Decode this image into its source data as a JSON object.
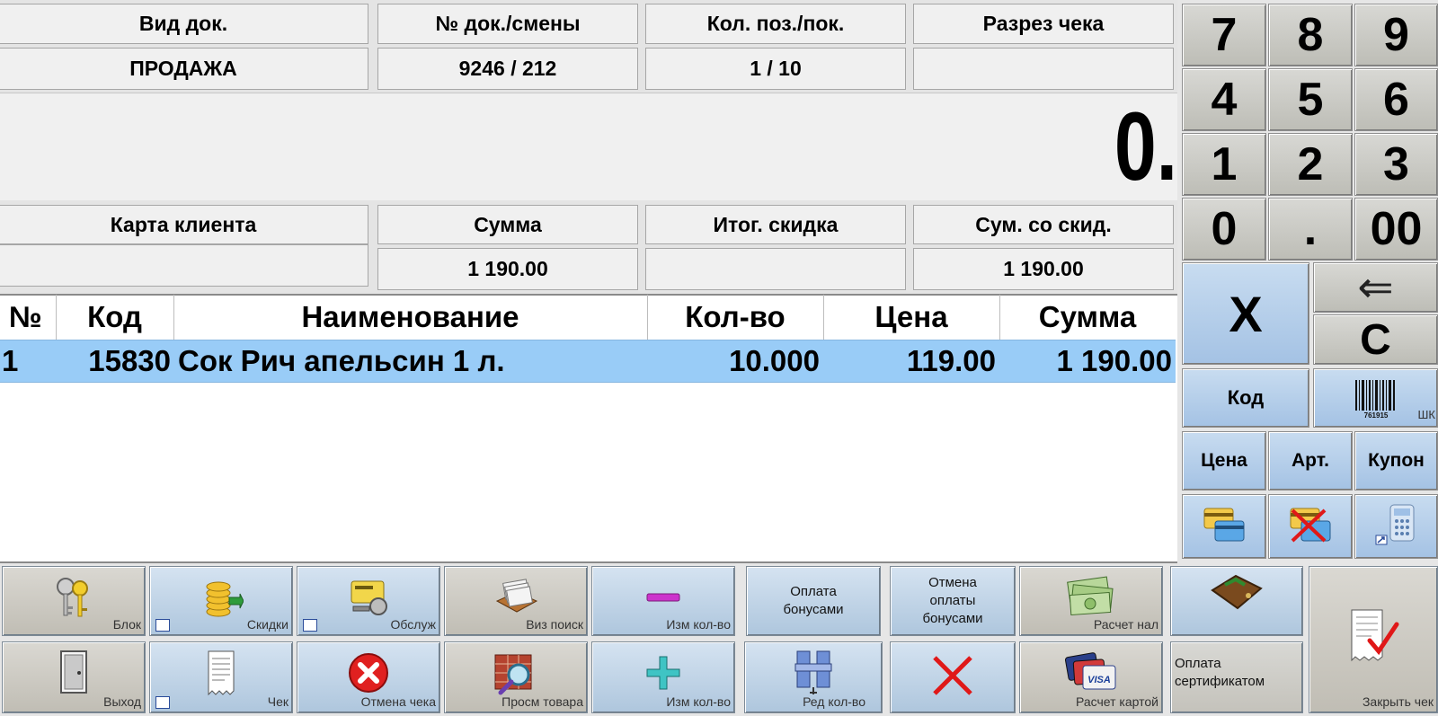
{
  "info_headers": [
    "Вид док.",
    "№ док./смены",
    "Кол. поз./пок.",
    "Разрез чека"
  ],
  "info_values": [
    "ПРОДАЖА",
    "9246 / 212",
    "1 / 10",
    ""
  ],
  "display_value": "0.",
  "summary_headers": [
    "Карта клиента",
    "Сумма",
    "Итог. скидка",
    "Сум. со скид."
  ],
  "summary_values": [
    "",
    "1 190.00",
    "",
    "1 190.00"
  ],
  "table": {
    "columns": [
      "№",
      "Код",
      "Наименование",
      "Кол-во",
      "Цена",
      "Сумма"
    ],
    "rows": [
      {
        "num": "1",
        "code": "15830",
        "name": "Сок Рич апельсин 1 л.",
        "qty": "10.000",
        "price": "119.00",
        "sum": "1 190.00"
      }
    ]
  },
  "keypad": {
    "digits": [
      "7",
      "8",
      "9",
      "4",
      "5",
      "6",
      "1",
      "2",
      "3",
      "0",
      ".",
      "00"
    ],
    "multiply": "X",
    "backspace": "⇐",
    "clear": "C",
    "code": "Код",
    "barcode": "ШК",
    "price": "Цена",
    "article": "Арт.",
    "coupon": "Купон"
  },
  "functions": {
    "block": "Блок",
    "discounts": "Скидки",
    "service": "Обслуж",
    "visual_search": "Виз поиск",
    "change_qty_minus": "Изм кол-во",
    "pay_bonus": "Оплата бонусами",
    "cancel_bonus": "Отмена оплаты бонусами",
    "cash_payment": "Расчет нал",
    "exit": "Выход",
    "receipt": "Чек",
    "cancel_receipt": "Отмена чека",
    "view_goods": "Просм товара",
    "change_qty_plus": "Изм кол-во",
    "edit_qty": "Ред кол-во",
    "card_payment": "Расчет картой",
    "certificate_payment": "Оплата сертификатом",
    "close_receipt": "Закрыть чек"
  },
  "colors": {
    "selected_row": "#99ccf7",
    "panel_gray": "#f0f0f0",
    "key_blue": "#b4cde6",
    "key_gray": "#cfcdc6"
  }
}
